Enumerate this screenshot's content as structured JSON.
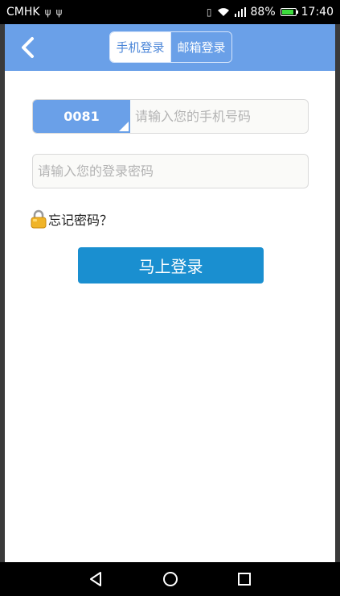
{
  "status_bar": {
    "carrier": "CMHK",
    "battery_percent": "88%",
    "time": "17:40",
    "icons": [
      "usb-icon",
      "usb-icon",
      "vibrate-icon",
      "wifi-icon",
      "signal-icon",
      "battery-icon"
    ]
  },
  "header": {
    "tabs": [
      {
        "label": "手机登录",
        "active": true
      },
      {
        "label": "邮箱登录",
        "active": false
      }
    ]
  },
  "form": {
    "country_code": "0081",
    "phone_placeholder": "请输入您的手机号码",
    "password_placeholder": "请输入您的登录密码",
    "forgot_label": "忘记密码？",
    "login_label": "马上登录"
  },
  "colors": {
    "header_bg": "#6aa0e8",
    "button_bg": "#1a8fd0"
  }
}
